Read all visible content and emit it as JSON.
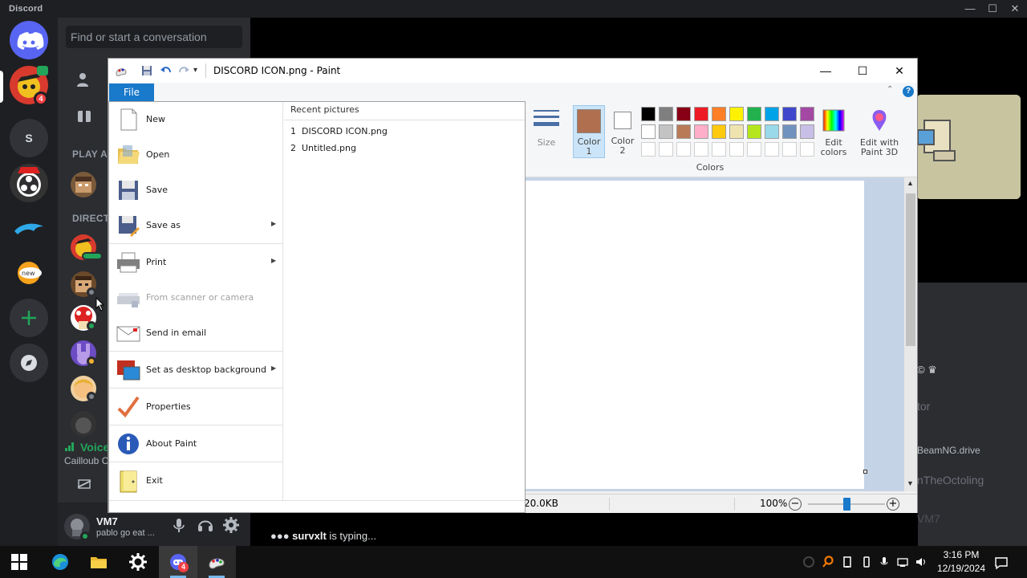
{
  "discord": {
    "brand": "Discord",
    "window_controls": {
      "minimize": "—",
      "maximize": "☐",
      "close": "✕"
    },
    "search_placeholder": "Find or start a conversation",
    "guild_s_label": "S",
    "guild_badge_count": "4",
    "sections": {
      "play_activity": "PLAY AC",
      "direct_messages": "DIRECT"
    },
    "voice": {
      "label": "Voice",
      "sub": "Cailloub C"
    },
    "user": {
      "name": "VM7",
      "status": "pablo go eat ..."
    },
    "members": [
      "tor",
      "BeamNG.drive",
      "nTheOctoling",
      "VM7"
    ],
    "typing": {
      "user": "survxlt",
      "text": " is typing..."
    }
  },
  "paint": {
    "title": "DISCORD ICON.png - Paint",
    "file_tab": "File",
    "menu_items": [
      {
        "label": "New"
      },
      {
        "label": "Open"
      },
      {
        "label": "Save"
      },
      {
        "label": "Save as"
      },
      {
        "label": "Print"
      },
      {
        "label": "From scanner or camera"
      },
      {
        "label": "Send in email"
      },
      {
        "label": "Set as desktop background"
      },
      {
        "label": "Properties"
      },
      {
        "label": "About Paint"
      },
      {
        "label": "Exit"
      }
    ],
    "recent_header": "Recent pictures",
    "recent": [
      {
        "num": "1",
        "name": "DISCORD ICON.png"
      },
      {
        "num": "2",
        "name": "Untitled.png"
      }
    ],
    "ribbon": {
      "size": "Size",
      "color1_line1": "Color",
      "color1_line2": "1",
      "color2_line1": "Color",
      "color2_line2": "2",
      "edit_colors_line1": "Edit",
      "edit_colors_line2": "colors",
      "paint3d_line1": "Edit with",
      "paint3d_line2": "Paint 3D",
      "colors_group": "Colors",
      "color1_value": "#b07050",
      "color2_value": "#ffffff",
      "palette_row1": [
        "#000000",
        "#7f7f7f",
        "#880015",
        "#ed1c24",
        "#ff7f27",
        "#fff200",
        "#22b14c",
        "#00a2e8",
        "#3f48cc",
        "#a349a4"
      ],
      "palette_row2": [
        "#ffffff",
        "#c3c3c3",
        "#b97a57",
        "#ffaec9",
        "#ffc90e",
        "#efe4b0",
        "#b5e61d",
        "#99d9ea",
        "#7092be",
        "#c8bfe7"
      ]
    },
    "status": {
      "file_size": "20.0KB",
      "zoom": "100%",
      "zoom_level": 0.5
    }
  },
  "taskbar": {
    "time": "3:16 PM",
    "date": "12/19/2024",
    "discord_badge": "4"
  }
}
